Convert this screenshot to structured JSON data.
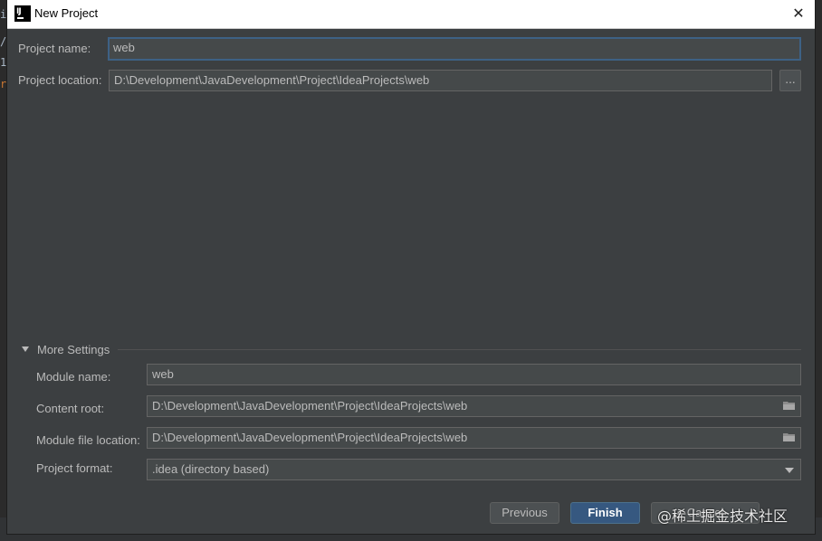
{
  "editor_background": {
    "glyphs": [
      "i",
      "/",
      "1",
      "r"
    ]
  },
  "dialog": {
    "title": "New Project",
    "close_symbol": "✕",
    "app_icon_letter": "IJ"
  },
  "fields": {
    "project_name": {
      "label": "Project name:",
      "value": "web"
    },
    "project_location": {
      "label": "Project location:",
      "value": "D:\\Development\\JavaDevelopment\\Project\\IdeaProjects\\web",
      "browse_label": "..."
    }
  },
  "more_settings": {
    "label": "More Settings",
    "expanded": true,
    "module_name": {
      "label": "Module name:",
      "value": "web"
    },
    "content_root": {
      "label": "Content root:",
      "value": "D:\\Development\\JavaDevelopment\\Project\\IdeaProjects\\web"
    },
    "module_file_location": {
      "label": "Module file location:",
      "value": "D:\\Development\\JavaDevelopment\\Project\\IdeaProjects\\web"
    },
    "project_format": {
      "label": "Project format:",
      "selected": ".idea (directory based)"
    }
  },
  "buttons": {
    "previous": "Previous",
    "finish": "Finish",
    "cancel": "Cancel"
  },
  "watermark": "@稀土掘金技术社区",
  "colors": {
    "dialog_bg": "#3c3f41",
    "field_bg": "#45494a",
    "focus_border": "#3d6185",
    "primary_button": "#365880"
  }
}
